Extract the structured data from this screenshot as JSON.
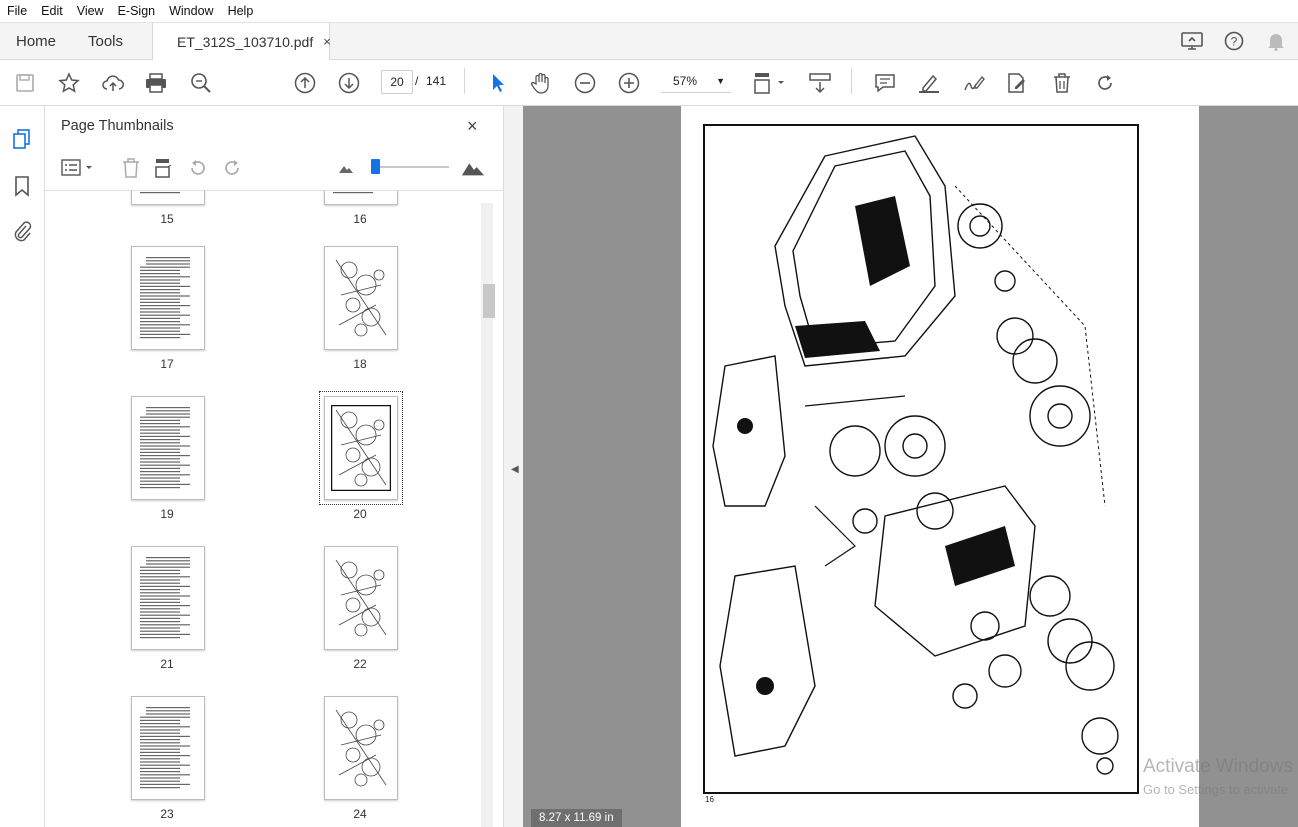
{
  "menu": [
    "File",
    "Edit",
    "View",
    "E-Sign",
    "Window",
    "Help"
  ],
  "tabs": {
    "home": "Home",
    "tools": "Tools",
    "document": "ET_312S_103710.pdf",
    "close_symbol": "×"
  },
  "toolbar": {
    "current_page": "20",
    "page_separator": "/",
    "total_pages": "141",
    "zoom": "57%"
  },
  "panel": {
    "title": "Page Thumbnails",
    "close_symbol": "×"
  },
  "thumbnails": [
    {
      "label": "15",
      "kind": "partial"
    },
    {
      "label": "16",
      "kind": "partial"
    },
    {
      "label": "17",
      "kind": "list"
    },
    {
      "label": "18",
      "kind": "drawing"
    },
    {
      "label": "19",
      "kind": "list"
    },
    {
      "label": "20",
      "kind": "drawing",
      "selected": true
    },
    {
      "label": "21",
      "kind": "list"
    },
    {
      "label": "22",
      "kind": "drawing"
    },
    {
      "label": "23",
      "kind": "list"
    },
    {
      "label": "24",
      "kind": "drawing"
    }
  ],
  "viewer": {
    "page_size": "8.27 x 11.69 in",
    "page_number_printed": "16",
    "watermark_title": "Activate Windows",
    "watermark_sub": "Go to Settings to activate"
  },
  "colors": {
    "accent": "#1473e6",
    "viewer_bg": "#919191"
  }
}
